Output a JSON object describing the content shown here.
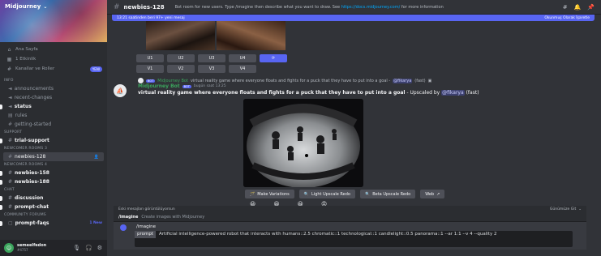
{
  "server": {
    "name": "Midjourney"
  },
  "nav": [
    {
      "icon": "home-icon",
      "label": "Ana Sayfa"
    },
    {
      "icon": "calendar-icon",
      "label": "1 Etkinlik"
    },
    {
      "icon": "channels-icon",
      "label": "Kanallar ve Roller",
      "badge": "YENI"
    }
  ],
  "categories": {
    "info": "Info",
    "support": "Support",
    "newcomer3": "Newcomer Rooms 3",
    "newcomer4": "Newcomer Rooms 4",
    "chat": "Chat",
    "community": "Community Forums"
  },
  "channels": {
    "announcements": "announcements",
    "recent_changes": "recent-changes",
    "status": "status",
    "rules": "rules",
    "getting_started": "getting-started",
    "trial_support": "trial-support",
    "newbies_128": "newbies-128",
    "newbies_158": "newbies-158",
    "newbies_188": "newbies-188",
    "discussion": "discussion",
    "prompt_chat": "prompt-chat",
    "prompt_faqs": "prompt-faqs",
    "prompt_faqs_tag": "1 New"
  },
  "user": {
    "name": "semeelfedon",
    "tag": "#4757"
  },
  "topbar": {
    "channel": "newbies-128",
    "topic_text": "Bot room for new users. Type /imagine then describe what you want to draw. See",
    "topic_link": "https://docs.midjourney.com/",
    "topic_tail": "for more information"
  },
  "newbar": {
    "left": "13:21 saatinden beri 97+ yeni mesaj",
    "right": "Okunmuş Olarak İşaretle"
  },
  "upscale_buttons": [
    "U1",
    "U2",
    "U3",
    "U4"
  ],
  "variation_buttons": [
    "V1",
    "V2",
    "V3",
    "V4"
  ],
  "message": {
    "reply_author": "Midjourney Bot",
    "reply_text": "virtual reality game where everyone floats and fights for a puck that they have to put into a goal -",
    "reply_mention": "@fikarya",
    "reply_tail": "(fast)",
    "author": "Midjourney Bot",
    "bot_tag": "BOT",
    "time": "bugün saat 13:25",
    "body_bold": "virtual reality game where everyone floats and fights for a puck that they have to put into a goal",
    "body_mid": "- Upscaled by",
    "body_mention": "@fikarya",
    "body_tail": "(fast)"
  },
  "action_buttons": [
    "Make Variations",
    "Light Upscale Redo",
    "Beta Upscale Redo",
    "Web"
  ],
  "oldbar": {
    "left": "Eski mesajları görüntülüyorsun",
    "right": "Günümüze Git"
  },
  "command": {
    "name": "/imagine",
    "description": "Create images with Midjourney"
  },
  "composer": {
    "command": "/imagine",
    "label": "prompt",
    "text": "Artificial intelligence-powered robot that interacts with humans::2.5 chromatic::1 technological::1 candlelight::0.5 panorama::1 --ar 1:1 --v 4 --quality 2"
  }
}
